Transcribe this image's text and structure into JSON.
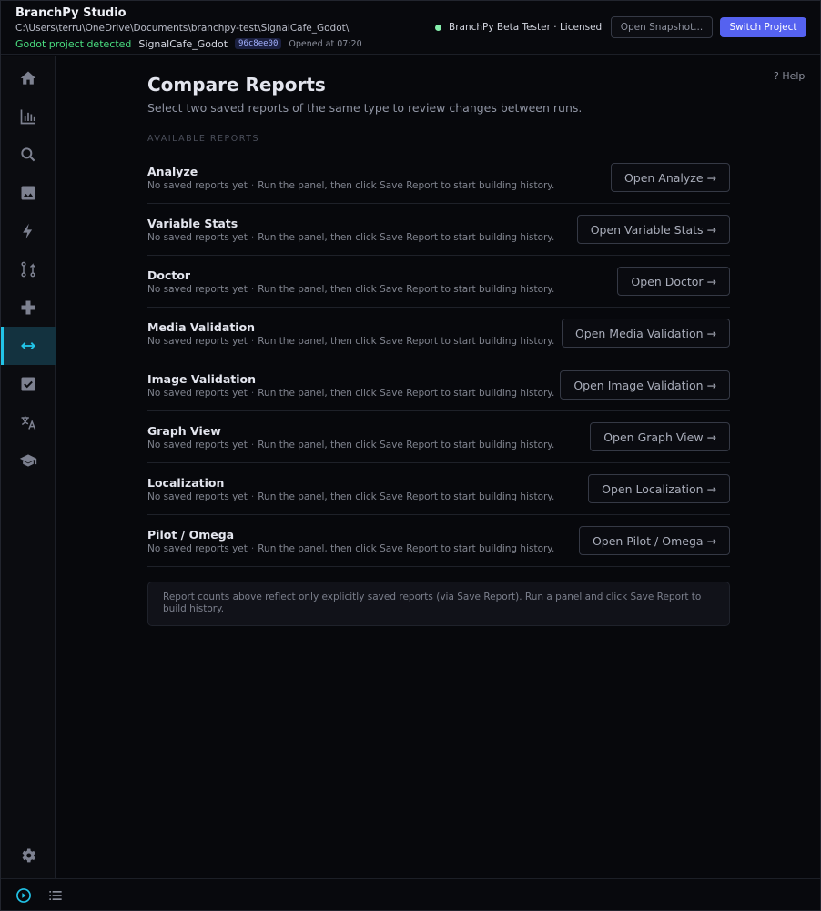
{
  "header": {
    "app_title": "BranchPy Studio",
    "project_path": "C:\\Users\\terru\\OneDrive\\Documents\\branchpy-test\\SignalCafe_Godot\\",
    "detected_label": "Godot project detected",
    "project_name": "SignalCafe_Godot",
    "commit_hash": "96c8ee00",
    "opened_at": "Opened at 07:20",
    "license_text": "BranchPy Beta Tester · Licensed",
    "license_status_color": "#86efac",
    "open_snapshot_label": "Open Snapshot...",
    "switch_project_label": "Switch Project"
  },
  "sidebar": {
    "items": [
      {
        "icon": "home-icon",
        "active": false
      },
      {
        "icon": "bar-chart-icon",
        "active": false
      },
      {
        "icon": "search-icon",
        "active": false
      },
      {
        "icon": "image-icon",
        "active": false
      },
      {
        "icon": "bolt-icon",
        "active": false
      },
      {
        "icon": "branch-icon",
        "active": false
      },
      {
        "icon": "plus-icon",
        "active": false
      },
      {
        "icon": "compare-arrows-icon",
        "active": true
      },
      {
        "icon": "checkbox-icon",
        "active": false
      },
      {
        "icon": "translate-icon",
        "active": false
      },
      {
        "icon": "graduation-cap-icon",
        "active": false
      }
    ],
    "settings_icon": "gear-icon"
  },
  "main": {
    "help_label": "? Help",
    "title": "Compare Reports",
    "subtitle": "Select two saved reports of the same type to review changes between runs.",
    "section_label": "AVAILABLE REPORTS",
    "reports": [
      {
        "name": "Analyze",
        "status": "No saved reports yet",
        "hint": "Run the panel, then click Save Report to start building history.",
        "button": "Open Analyze →"
      },
      {
        "name": "Variable Stats",
        "status": "No saved reports yet",
        "hint": "Run the panel, then click Save Report to start building history.",
        "button": "Open Variable Stats →"
      },
      {
        "name": "Doctor",
        "status": "No saved reports yet",
        "hint": "Run the panel, then click Save Report to start building history.",
        "button": "Open Doctor →"
      },
      {
        "name": "Media Validation",
        "status": "No saved reports yet",
        "hint": "Run the panel, then click Save Report to start building history.",
        "button": "Open Media Validation →"
      },
      {
        "name": "Image Validation",
        "status": "No saved reports yet",
        "hint": "Run the panel, then click Save Report to start building history.",
        "button": "Open Image Validation →"
      },
      {
        "name": "Graph View",
        "status": "No saved reports yet",
        "hint": "Run the panel, then click Save Report to start building history.",
        "button": "Open Graph View →"
      },
      {
        "name": "Localization",
        "status": "No saved reports yet",
        "hint": "Run the panel, then click Save Report to start building history.",
        "button": "Open Localization →"
      },
      {
        "name": "Pilot / Omega",
        "status": "No saved reports yet",
        "hint": "Run the panel, then click Save Report to start building history.",
        "button": "Open Pilot / Omega →"
      }
    ],
    "note": "Report counts above reflect only explicitly saved reports (via Save Report). Run a panel and click Save Report to build history."
  },
  "bottombar": {
    "icons": [
      "play-circle-icon",
      "list-icon"
    ]
  },
  "colors": {
    "accent": "#5562f0",
    "active_nav": "#22c4e8",
    "detected": "#4ade80"
  }
}
